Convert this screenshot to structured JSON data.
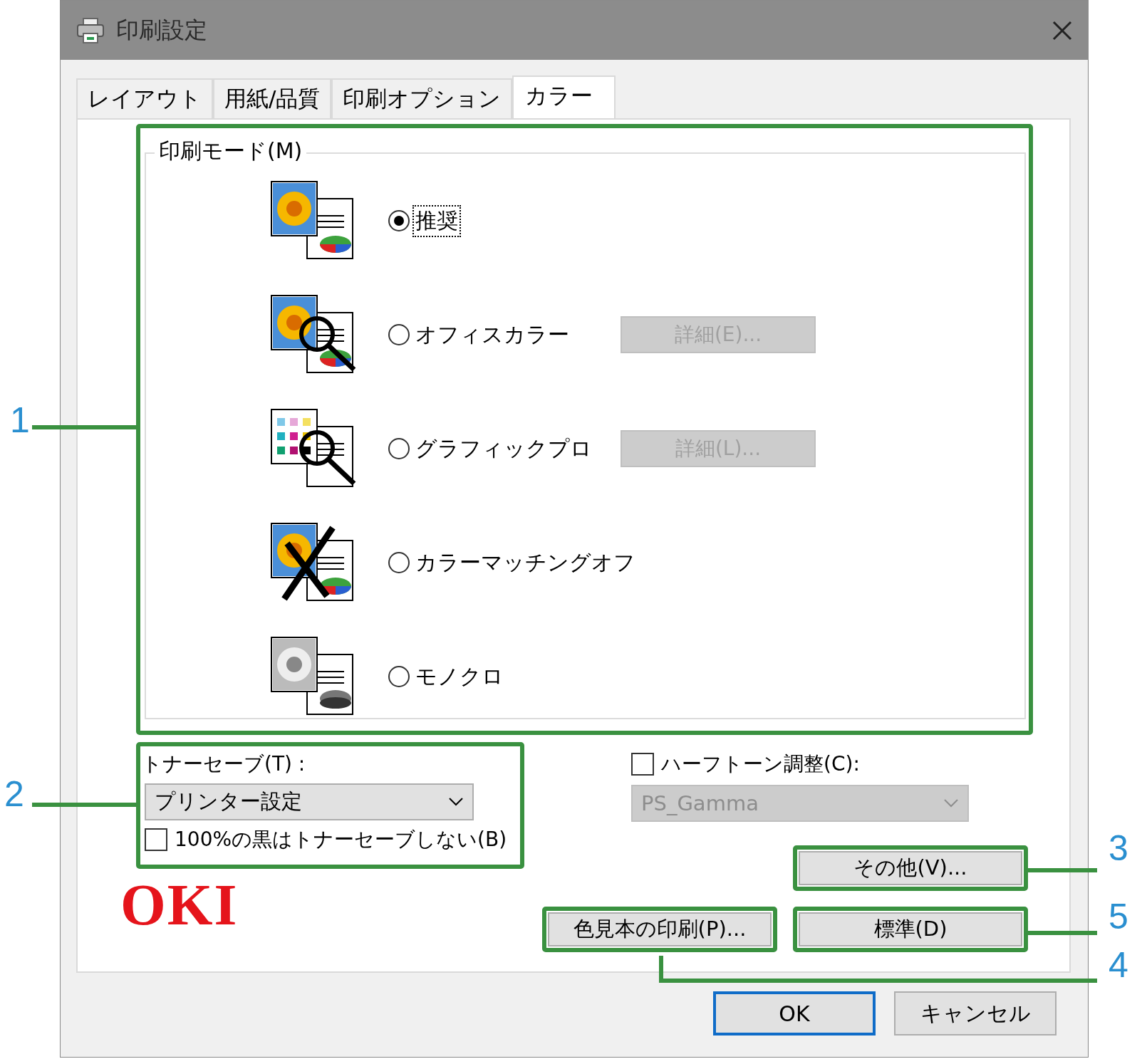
{
  "window": {
    "title": "印刷設定"
  },
  "tabs": [
    {
      "label": "レイアウト",
      "selected": false
    },
    {
      "label": "用紙/品質",
      "selected": false
    },
    {
      "label": "印刷オプション",
      "selected": false
    },
    {
      "label": "カラー",
      "selected": true
    }
  ],
  "print_mode": {
    "legend": "印刷モード(M)",
    "options": [
      {
        "kind": "photo",
        "label": "推奨",
        "selected": true
      },
      {
        "kind": "magnifier",
        "label": "オフィスカラー",
        "selected": false,
        "details_button": {
          "label": "詳細(E)...",
          "disabled": true
        }
      },
      {
        "kind": "swatches",
        "label": "グラフィックプロ",
        "selected": false,
        "details_button": {
          "label": "詳細(L)...",
          "disabled": true
        }
      },
      {
        "kind": "crossed",
        "label": "カラーマッチングオフ",
        "selected": false
      },
      {
        "kind": "mono",
        "label": "モノクロ",
        "selected": false
      }
    ]
  },
  "toner_save": {
    "label": "トナーセーブ(T) :",
    "value": "プリンター設定",
    "checkbox": {
      "label": "100%の黒はトナーセーブしない(B)",
      "checked": false
    }
  },
  "halftone": {
    "label": "ハーフトーン調整(C):",
    "checked": false,
    "value": "PS_Gamma",
    "disabled": true
  },
  "logo": "OKI",
  "buttons": {
    "other": "その他(V)...",
    "color_sample": "色見本の印刷(P)...",
    "standard": "標準(D)"
  },
  "dialog_buttons": [
    {
      "label": "OK",
      "default": true
    },
    {
      "label": "キャンセル",
      "default": false
    }
  ],
  "callouts": [
    "1",
    "2",
    "3",
    "5",
    "4"
  ]
}
